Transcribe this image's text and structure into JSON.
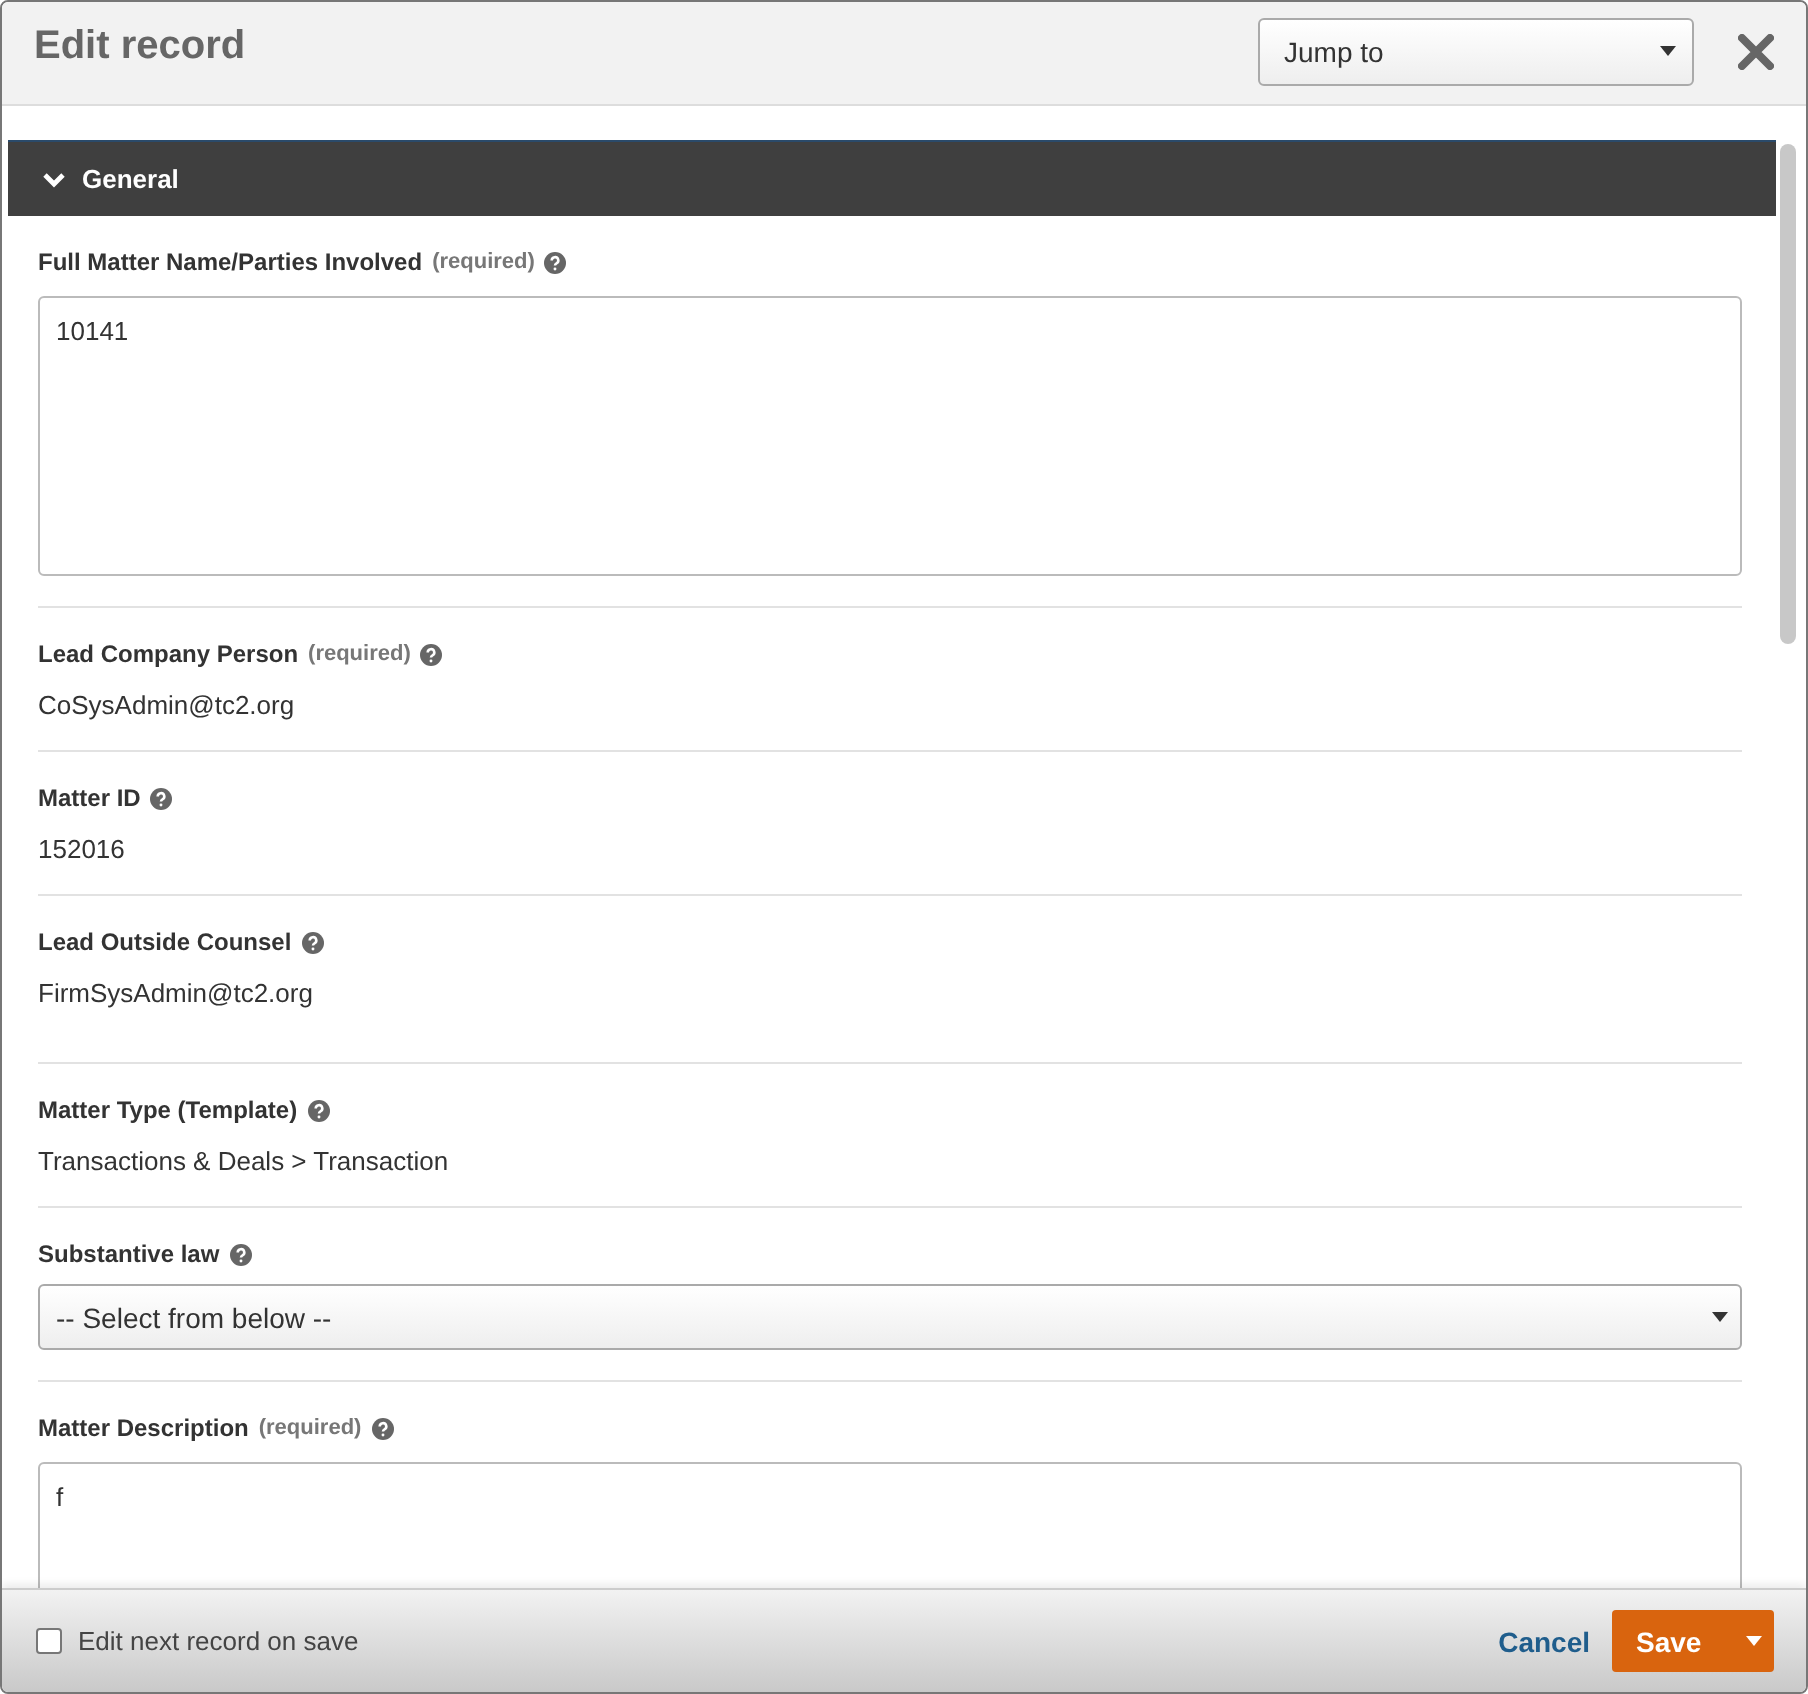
{
  "window": {
    "title": "Edit record"
  },
  "jump_to": {
    "value": "Jump to"
  },
  "section": {
    "title": "General",
    "expanded": true
  },
  "fields": [
    {
      "kind": "textarea",
      "label": "Full Matter Name/Parties Involved",
      "required": "(required)",
      "value": "10141"
    },
    {
      "kind": "static",
      "label": "Lead Company Person",
      "required": "(required)",
      "value": "CoSysAdmin@tc2.org"
    },
    {
      "kind": "static",
      "label": "Matter ID",
      "value": "152016"
    },
    {
      "kind": "static",
      "label": "Lead Outside Counsel",
      "value": "FirmSysAdmin@tc2.org"
    },
    {
      "kind": "static",
      "label": "Matter Type (Template)",
      "value": "Transactions & Deals > Transaction"
    },
    {
      "kind": "select",
      "label": "Substantive law",
      "value": "-- Select from below --"
    },
    {
      "kind": "textarea",
      "label": "Matter Description",
      "required": "(required)",
      "value": "f"
    }
  ],
  "footer": {
    "edit_next": {
      "label": "Edit next record on save",
      "checked": false
    },
    "cancel": "Cancel",
    "save": "Save"
  }
}
